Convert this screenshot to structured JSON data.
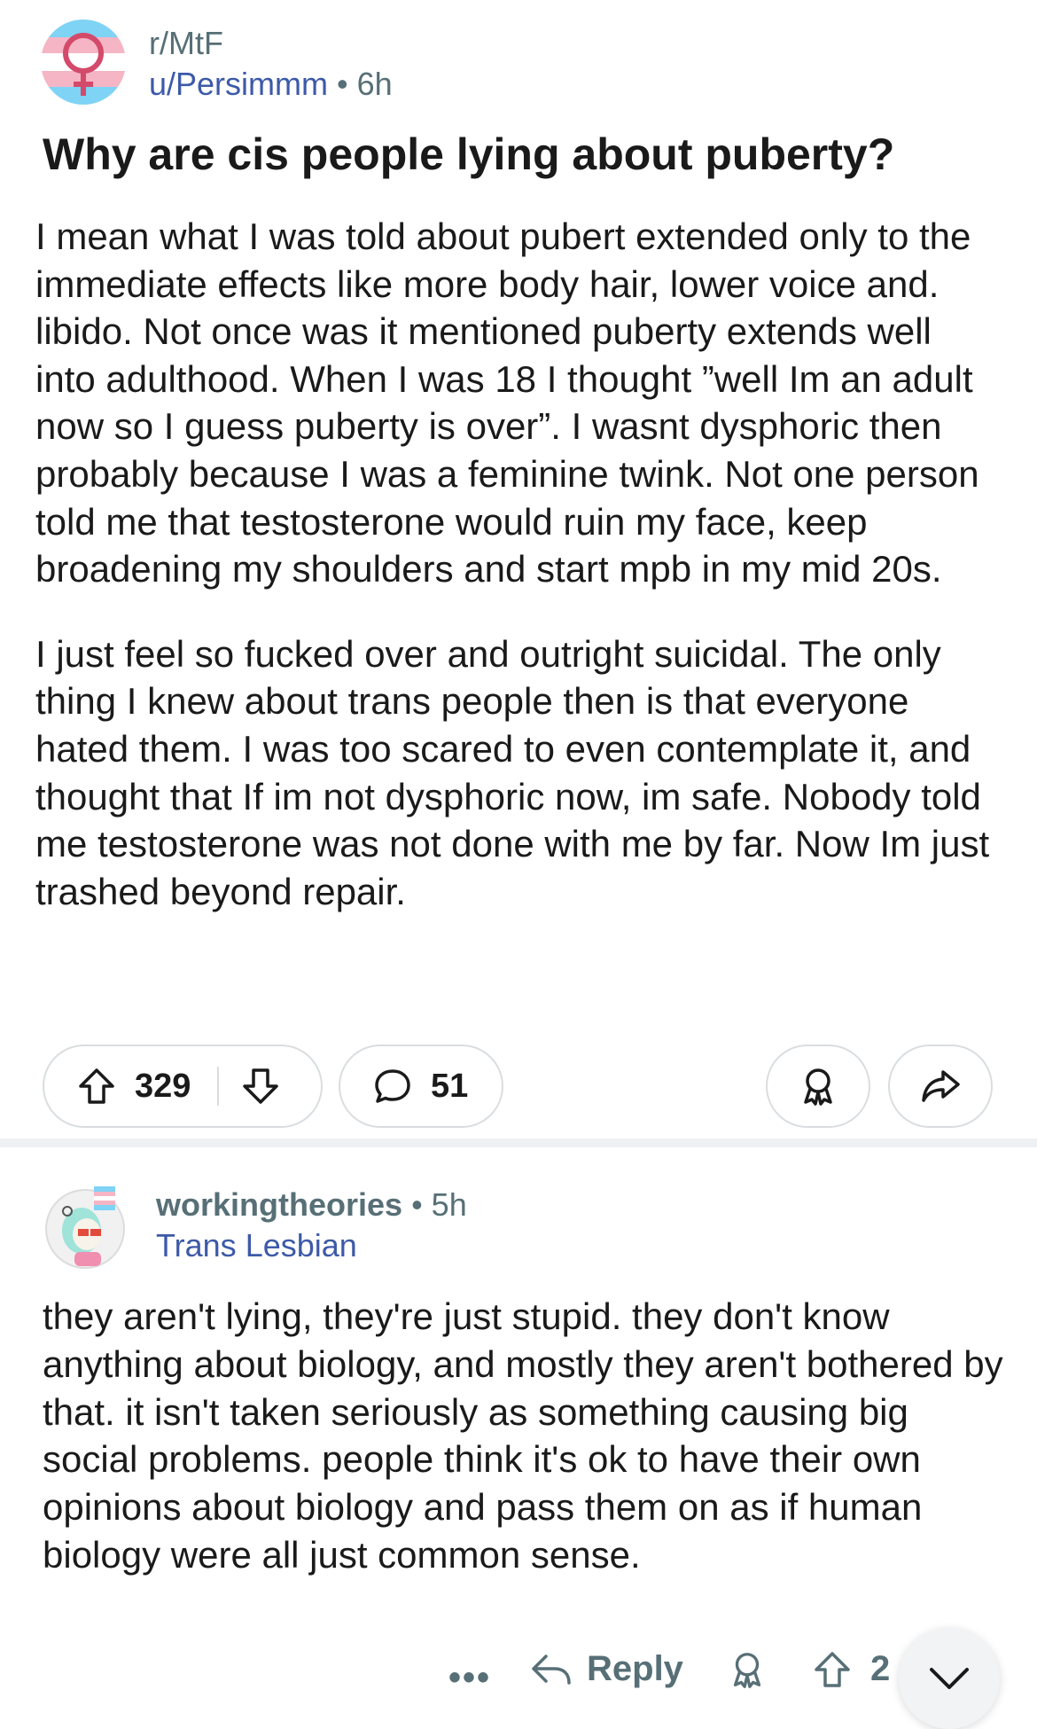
{
  "post": {
    "subreddit": "r/MtF",
    "author": "u/Persimmm",
    "age": "6h",
    "title": "Why are cis people lying about puberty?",
    "body": [
      "I mean what I was told about pubert extended only to the immediate effects like more body hair, lower voice and. libido. Not once was it mentioned puberty extends well into adulthood. When I was 18 I thought ”well Im an adult now so I guess puberty is over”. I wasnt dysphoric then probably because I was a feminine twink. Not one person told me that testosterone would ruin my face, keep broadening my shoulders and start mpb in my mid 20s.",
      "I just feel so fucked over and outright suicidal. The only thing I knew about trans people then is that everyone hated them. I was too scared to even contemplate it, and thought that If im not dysphoric now, im safe. Nobody told me testosterone was not done with me by far. Now Im just trashed beyond repair."
    ],
    "upvotes": "329",
    "comments": "51"
  },
  "comment": {
    "author": "workingtheories",
    "age": "5h",
    "flair": "Trans Lesbian",
    "body": "they aren't lying, they're just stupid.  they don't know anything about biology, and mostly they aren't bothered by that.  it isn't taken seriously as something causing big social problems.  people think it's ok to have their own opinions about biology and pass them on as if human biology were all just common sense.",
    "more": "•••",
    "reply_label": "Reply",
    "upvotes": "2"
  },
  "icons": {
    "subreddit_avatar": "trans-flag-venus-icon",
    "upvote": "arrow-up-icon",
    "downvote": "arrow-down-icon",
    "comment": "speech-bubble-icon",
    "award": "award-icon",
    "share": "share-arrow-icon",
    "reply": "reply-arrow-icon",
    "scroll": "chevron-down-icon"
  },
  "colors": {
    "trans_blue": "#5bcefa",
    "trans_pink": "#f5a9b8",
    "venus_red": "#d34a6a",
    "link_blue": "#3d5aa8",
    "meta_gray": "#576f76"
  }
}
